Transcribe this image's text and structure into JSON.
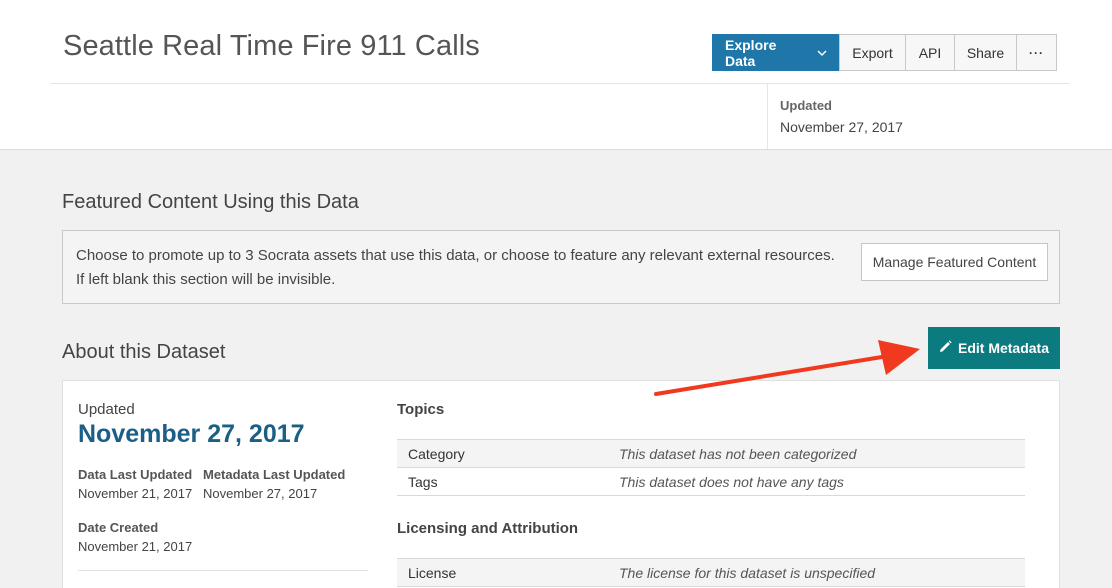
{
  "header": {
    "title": "Seattle Real Time Fire 911 Calls",
    "updated_label": "Updated",
    "updated_value": "November 27, 2017"
  },
  "toolbar": {
    "explore": "Explore Data",
    "export": "Export",
    "api": "API",
    "share": "Share",
    "more": "···"
  },
  "featured": {
    "title": "Featured Content Using this Data",
    "text": "Choose to promote up to 3 Socrata assets that use this data, or choose to feature any relevant external resources. If left blank this section will be invisible.",
    "manage_button": "Manage Featured Content"
  },
  "about": {
    "title": "About this Dataset",
    "edit_button": "Edit Metadata",
    "updated_label": "Updated",
    "updated_value": "November 27, 2017",
    "data_last_updated_label": "Data Last Updated",
    "data_last_updated_value": "November 21, 2017",
    "metadata_last_updated_label": "Metadata Last Updated",
    "metadata_last_updated_value": "November 27, 2017",
    "date_created_label": "Date Created",
    "date_created_value": "November 21, 2017",
    "topics_heading": "Topics",
    "topics": [
      {
        "key": "Category",
        "value": "This dataset has not been categorized"
      },
      {
        "key": "Tags",
        "value": "This dataset does not have any tags"
      }
    ],
    "licensing_heading": "Licensing and Attribution",
    "licensing": [
      {
        "key": "License",
        "value": "The license for this dataset is unspecified"
      }
    ]
  },
  "colors": {
    "primary_blue": "#1e77a8",
    "teal": "#0c7b80",
    "date_blue": "#1b5f86",
    "arrow_red": "#f0391f"
  }
}
